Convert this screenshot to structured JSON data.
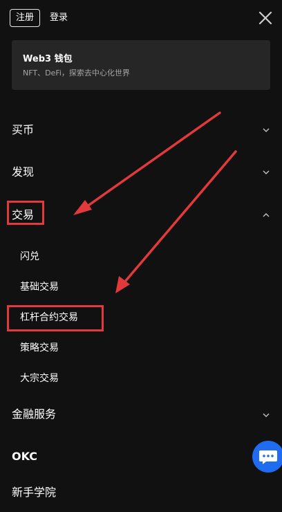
{
  "header": {
    "register_label": "注册",
    "login_label": "登录",
    "close_icon": "close-icon"
  },
  "wallet": {
    "title": "Web3 钱包",
    "subtitle": "NFT、DeFi，探索去中心化世界"
  },
  "menu": {
    "buy": "买币",
    "discover": "发现",
    "trade": "交易",
    "trade_sub": [
      "闪兑",
      "基础交易",
      "杠杆合约交易",
      "策略交易",
      "大宗交易"
    ],
    "finance": "金融服务",
    "okc": "OKC",
    "academy": "新手学院"
  },
  "colors": {
    "background": "#111111",
    "card": "#262626",
    "annotation": "#e23a3a",
    "chat_button": "#1f6cf0"
  },
  "icons": {
    "chevron_down": "chevron-down-icon",
    "chevron_up": "chevron-up-icon",
    "chat": "chat-icon"
  }
}
